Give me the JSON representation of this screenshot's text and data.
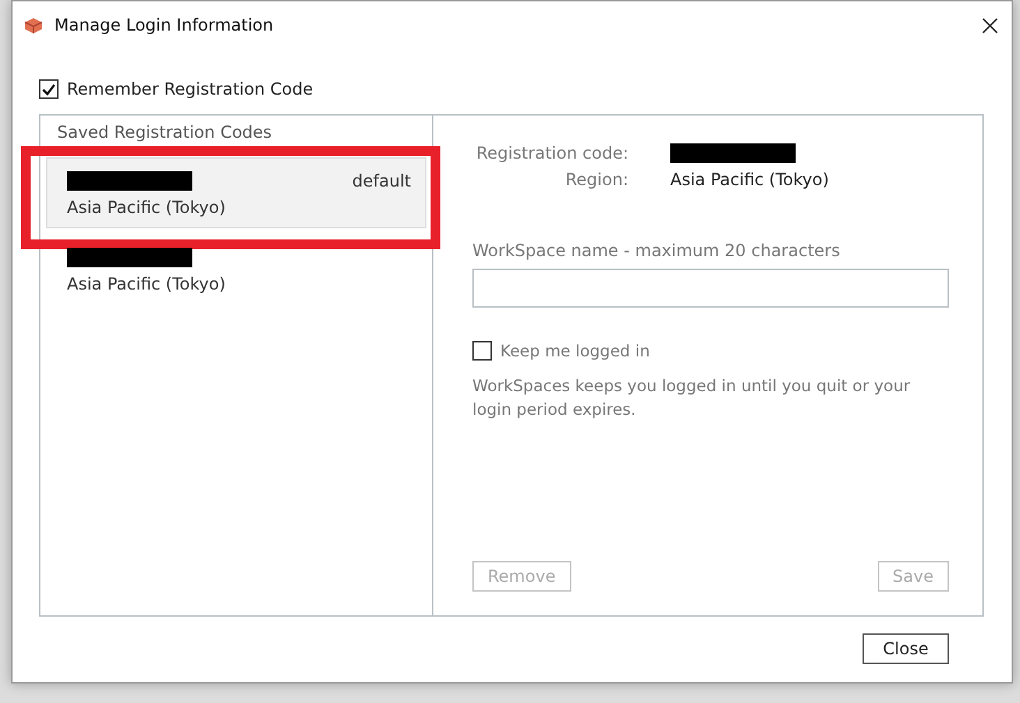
{
  "window": {
    "title": "Manage Login Information"
  },
  "remember_code": {
    "label": "Remember Registration Code",
    "checked": true
  },
  "saved_codes": {
    "heading": "Saved Registration Codes",
    "items": [
      {
        "code_redacted": true,
        "region": "Asia Pacific (Tokyo)",
        "tag": "default",
        "selected": true,
        "highlighted": true
      },
      {
        "code_redacted": true,
        "region": "Asia Pacific (Tokyo)",
        "selected": false,
        "highlighted": false
      }
    ]
  },
  "details": {
    "code_label": "Registration code:",
    "code_redacted": true,
    "region_label": "Region:",
    "region_value": "Asia Pacific (Tokyo)",
    "name_label": "WorkSpace name - maximum 20 characters",
    "keep_logged_in": {
      "label": "Keep me logged in",
      "checked": false
    },
    "note": "WorkSpaces keeps you logged in until you quit or your login period expires.",
    "buttons": [
      {
        "label": "Remove",
        "disabled": true
      },
      {
        "label": "Save",
        "disabled": true
      }
    ]
  },
  "footer_button": "Close"
}
